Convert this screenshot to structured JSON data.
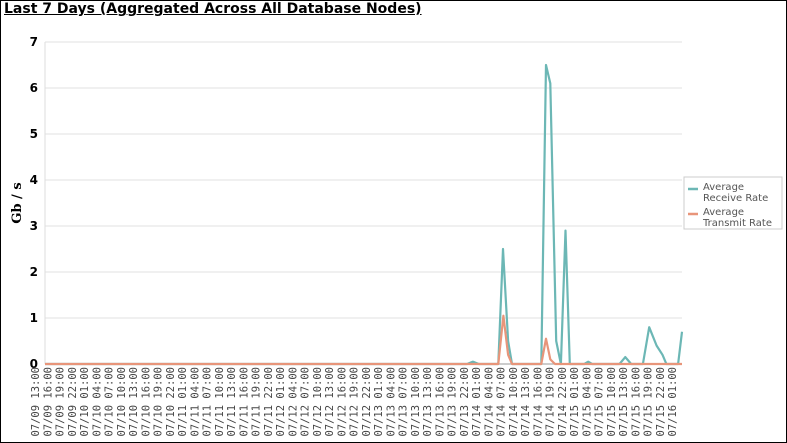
{
  "header": {
    "title": "Last 7 Days (Aggregated Across All Database Nodes)"
  },
  "chart_data": {
    "type": "line",
    "title": "Last 7 Days (Aggregated Across All Database Nodes)",
    "xlabel": "",
    "ylabel": "Gb / s",
    "ylim": [
      0,
      7
    ],
    "yticks": [
      0,
      1,
      2,
      3,
      4,
      5,
      6,
      7
    ],
    "grid": true,
    "legend_position": "right",
    "x_tick_labels": [
      "07/09 13:00",
      "07/09 16:00",
      "07/09 19:00",
      "07/09 22:00",
      "07/10 01:00",
      "07/10 04:00",
      "07/10 07:00",
      "07/10 10:00",
      "07/10 13:00",
      "07/10 16:00",
      "07/10 19:00",
      "07/10 22:00",
      "07/11 01:00",
      "07/11 04:00",
      "07/11 07:00",
      "07/11 10:00",
      "07/11 13:00",
      "07/11 16:00",
      "07/11 19:00",
      "07/11 22:00",
      "07/12 01:00",
      "07/12 04:00",
      "07/12 07:00",
      "07/12 10:00",
      "07/12 13:00",
      "07/12 16:00",
      "07/12 19:00",
      "07/12 22:00",
      "07/13 01:00",
      "07/13 04:00",
      "07/13 07:00",
      "07/13 10:00",
      "07/13 13:00",
      "07/13 16:00",
      "07/13 19:00",
      "07/13 22:00",
      "07/14 01:00",
      "07/14 04:00",
      "07/14 07:00",
      "07/14 10:00",
      "07/14 13:00",
      "07/14 16:00",
      "07/14 19:00",
      "07/14 22:00",
      "07/15 01:00",
      "07/15 04:00",
      "07/15 07:00",
      "07/15 10:00",
      "07/15 13:00",
      "07/15 16:00",
      "07/15 19:00",
      "07/15 22:00",
      "07/16 01:00"
    ],
    "x_range_hours": [
      0,
      156
    ],
    "series": [
      {
        "name": "Average Receive Rate",
        "color": "#6cb7b5",
        "points": [
          [
            0,
            0
          ],
          [
            108,
            0
          ],
          [
            109.5,
            0.05
          ],
          [
            111,
            0
          ],
          [
            116,
            0
          ],
          [
            117.2,
            2.5
          ],
          [
            118.5,
            0.5
          ],
          [
            119.5,
            0
          ],
          [
            127,
            0
          ],
          [
            128.2,
            6.5
          ],
          [
            129.3,
            6.1
          ],
          [
            130.8,
            0.5
          ],
          [
            132,
            0
          ],
          [
            133.2,
            2.9
          ],
          [
            134.3,
            0
          ],
          [
            138,
            0
          ],
          [
            139,
            0.05
          ],
          [
            140,
            0
          ],
          [
            147,
            0
          ],
          [
            148.5,
            0.15
          ],
          [
            150,
            0
          ],
          [
            153,
            0
          ],
          [
            154.6,
            0.8
          ],
          [
            156.5,
            0.4
          ],
          [
            158,
            0.2
          ],
          [
            159,
            0
          ],
          [
            162,
            0
          ],
          [
            163,
            0.7
          ]
        ]
      },
      {
        "name": "Average Transmit Rate",
        "color": "#e8957a",
        "points": [
          [
            0,
            0
          ],
          [
            116,
            0
          ],
          [
            117.3,
            1.05
          ],
          [
            118.5,
            0.2
          ],
          [
            119.5,
            0
          ],
          [
            127,
            0
          ],
          [
            128.2,
            0.55
          ],
          [
            129.3,
            0.1
          ],
          [
            130.5,
            0
          ],
          [
            163,
            0
          ]
        ]
      }
    ]
  }
}
